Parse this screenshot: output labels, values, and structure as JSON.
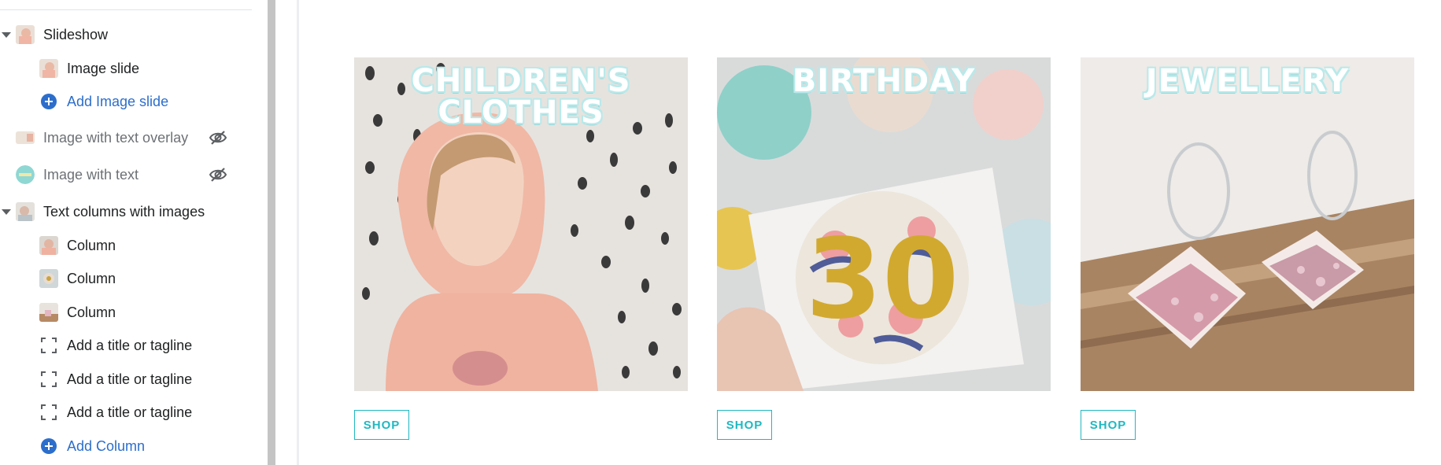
{
  "sidebar": {
    "sections": [
      {
        "label": "Slideshow",
        "style": "bold",
        "expanded": true,
        "thumb": "photo-girl"
      },
      {
        "label": "Image slide",
        "style": "bold",
        "thumb": "photo-girl"
      },
      {
        "label": "Add Image slide",
        "style": "link",
        "icon": "plus-circle-icon"
      },
      {
        "label": "Image with text overlay",
        "style": "muted",
        "thumb": "photo-landscape",
        "hidden": true
      },
      {
        "label": "Image with text",
        "style": "muted",
        "thumb": "photo-round",
        "hidden": true
      },
      {
        "label": "Text columns with images",
        "style": "bold",
        "expanded": true,
        "thumb": "photo-collage"
      },
      {
        "label": "Column",
        "style": "bold",
        "thumb": "photo-column-1"
      },
      {
        "label": "Column",
        "style": "bold",
        "thumb": "photo-column-2"
      },
      {
        "label": "Column",
        "style": "bold",
        "thumb": "photo-column-3"
      },
      {
        "label": "Add a title or tagline",
        "style": "bold",
        "icon": "frame-icon"
      },
      {
        "label": "Add a title or tagline",
        "style": "bold",
        "icon": "frame-icon"
      },
      {
        "label": "Add a title or tagline",
        "style": "bold",
        "icon": "frame-icon"
      },
      {
        "label": "Add Column",
        "style": "link",
        "icon": "plus-circle-icon"
      }
    ]
  },
  "preview": {
    "cards": [
      {
        "title_line1": "CHILDREN'S",
        "title_line2": "CLOTHES",
        "button": "SHOP"
      },
      {
        "title_line1": "BIRTHDAY",
        "title_line2": "",
        "button": "SHOP"
      },
      {
        "title_line1": "JEWELLERY",
        "title_line2": "",
        "button": "SHOP"
      }
    ]
  },
  "colors": {
    "accent_teal": "#1fb8c1",
    "link_blue": "#2c6ecb",
    "title_outline": "#b9e9ea"
  }
}
